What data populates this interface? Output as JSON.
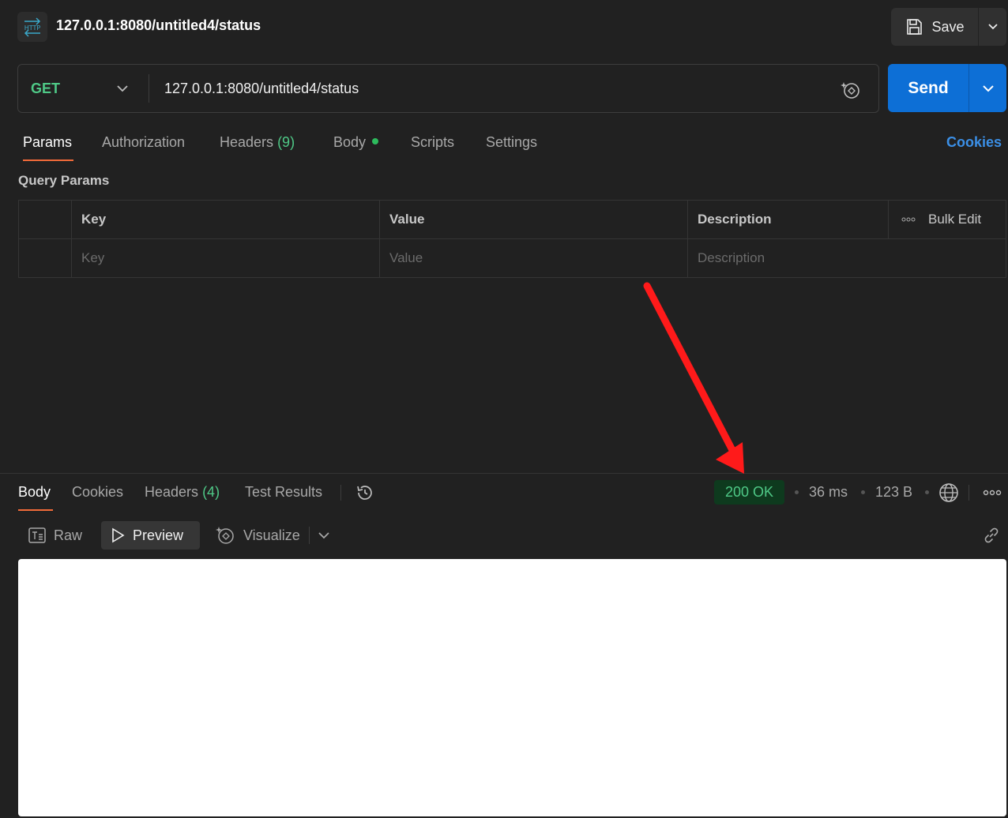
{
  "header": {
    "icon": "http-icon",
    "title": "127.0.0.1:8080/untitled4/status",
    "save_label": "Save"
  },
  "request": {
    "method": "GET",
    "url": "127.0.0.1:8080/untitled4/status",
    "send_label": "Send",
    "method_color": "#4fc987"
  },
  "tabs": [
    {
      "label": "Params",
      "active": true
    },
    {
      "label": "Authorization"
    },
    {
      "label": "Headers",
      "count": "(9)"
    },
    {
      "label": "Body",
      "indicator": "green-dot"
    },
    {
      "label": "Scripts"
    },
    {
      "label": "Settings"
    }
  ],
  "cookies_link": "Cookies",
  "query_params": {
    "label": "Query Params",
    "columns": [
      "Key",
      "Value",
      "Description"
    ],
    "bulk_edit": "Bulk Edit",
    "placeholders": {
      "key": "Key",
      "value": "Value",
      "description": "Description"
    }
  },
  "response": {
    "tabs": [
      {
        "label": "Body",
        "active": true
      },
      {
        "label": "Cookies"
      },
      {
        "label": "Headers",
        "count": "(4)"
      },
      {
        "label": "Test Results"
      }
    ],
    "status": "200 OK",
    "time": "36 ms",
    "size": "123 B",
    "status_color": "#4fc987",
    "view_modes": {
      "raw": "Raw",
      "preview": "Preview",
      "visualize": "Visualize"
    },
    "active_view": "Preview"
  },
  "colors": {
    "accent": "#f26b3a",
    "primary": "#0d6fd6",
    "annotation_arrow": "#ff1a1a"
  }
}
